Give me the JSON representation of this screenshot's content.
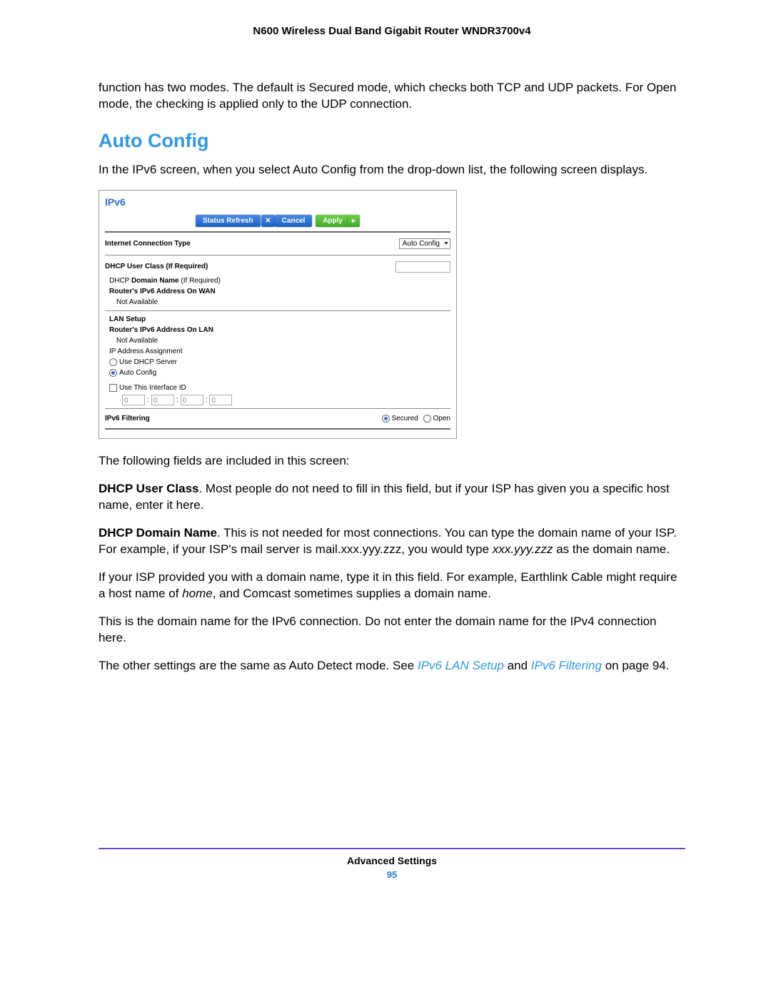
{
  "doc_title": "N600 Wireless Dual Band Gigabit Router WNDR3700v4",
  "intro_para": "function has two modes. The default is Secured mode, which checks both TCP and UDP packets. For Open mode, the checking is applied only to the UDP connection.",
  "section_heading": "Auto Config",
  "section_intro": "In the IPv6 screen, when you select Auto Config from the drop-down list, the following screen displays.",
  "router": {
    "title": "IPv6",
    "btn_status": "Status Refresh",
    "btn_cancel": "Cancel",
    "btn_apply": "Apply",
    "conn_type_label": "Internet Connection Type",
    "conn_type_value": "Auto Config",
    "dhcp_user_class": "DHCP User Class (If Required)",
    "dhcp_domain_name_a": "DHCP ",
    "dhcp_domain_name_b": "Domain Name ",
    "dhcp_domain_name_c": " (If Required)",
    "wan_addr_label": "Router's IPv6 Address On WAN",
    "not_available": "Not Available",
    "lan_setup": "LAN Setup",
    "lan_addr_label": "Router's IPv6 Address On LAN",
    "ip_assign": "IP Address Assignment",
    "opt_dhcp": "Use DHCP Server",
    "opt_auto": "Auto Config",
    "use_iface": "Use This Interface ID",
    "iface_val": "0",
    "filtering": "IPv6 Filtering",
    "filt_secured": "Secured",
    "filt_open": "Open"
  },
  "after_img": "The following fields are included in this screen:",
  "p_usercls_b": "DHCP User Class",
  "p_usercls": ". Most people do not need to fill in this field, but if your ISP has given you a specific host name, enter it here.",
  "p_domain_b": "DHCP Domain Name",
  "p_domain_1": ". This is not needed for most connections. You can type the domain name of your ISP. For example, if your ISP's mail server is mail.xxx.yyy.zzz, you would type ",
  "p_domain_i": "xxx.yyy.zzz",
  "p_domain_2": " as the domain name.",
  "p_isp_1": "If your ISP provided you with a domain name, type it in this field. For example, Earthlink Cable might require a host name of ",
  "p_isp_i": "home",
  "p_isp_2": ", and Comcast sometimes supplies a domain name.",
  "p_ipv4": "This is the domain name for the IPv6 connection. Do not enter the domain name for the IPv4 connection here.",
  "p_other_1": "The other settings are the same as Auto Detect mode. See ",
  "link_lan": "IPv6 LAN Setup",
  "p_other_2": " and ",
  "link_filt": "IPv6 Filtering",
  "p_other_3": " on page 94.",
  "footer_label": "Advanced Settings",
  "page_num": "95"
}
